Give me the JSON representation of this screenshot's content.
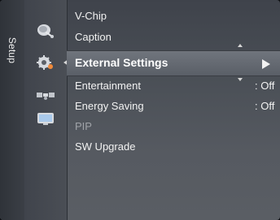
{
  "menu": {
    "section_title": "Setup",
    "items": [
      {
        "label": "V-Chip",
        "value": ""
      },
      {
        "label": "Caption",
        "value": ""
      },
      {
        "label": "External Settings",
        "value": "",
        "selected": true,
        "has_submenu": true
      },
      {
        "label": "Entertainment",
        "value": ": Off"
      },
      {
        "label": "Energy Saving",
        "value": ": Off"
      },
      {
        "label": "PIP",
        "value": "",
        "disabled": true
      },
      {
        "label": "SW Upgrade",
        "value": ""
      }
    ]
  },
  "icons": [
    {
      "name": "satellite-dish-icon"
    },
    {
      "name": "gear-icon"
    },
    {
      "name": "satellite-icon"
    },
    {
      "name": "monitor-icon"
    }
  ]
}
